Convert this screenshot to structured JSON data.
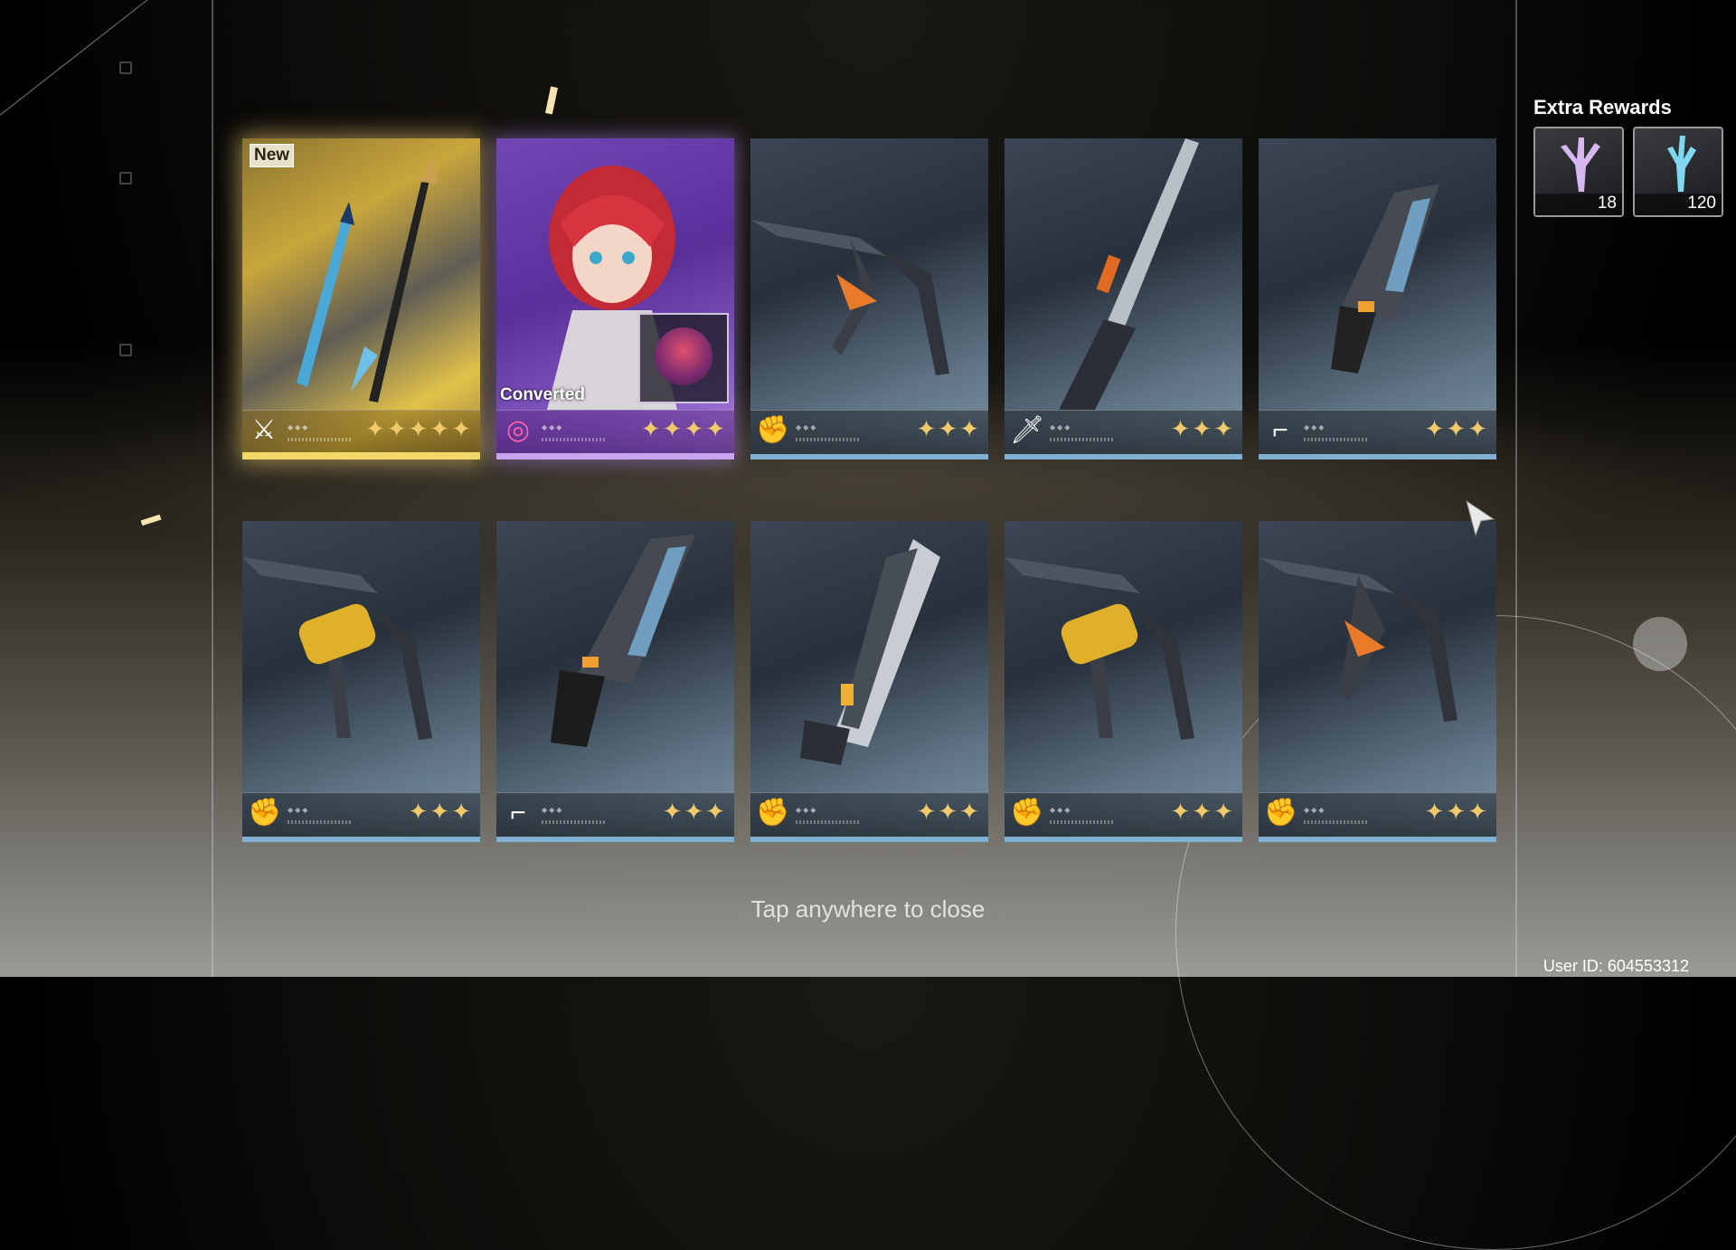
{
  "extra_rewards": {
    "title": "Extra Rewards",
    "items": [
      {
        "icon": "lustrous-coral-icon",
        "quantity": "18"
      },
      {
        "icon": "coral-icon",
        "quantity": "120"
      }
    ]
  },
  "cards": [
    {
      "badge": "New",
      "rarity": 5,
      "stars": "✦✦✦✦✦",
      "type_icon": "sword-type-icon",
      "item_icon": "katana-weapon-icon",
      "frame": "gold"
    },
    {
      "label": "Converted",
      "rarity": 4,
      "stars": "✦✦✦✦",
      "type_icon": "havoc-element-icon",
      "item_icon": "red-haired-resonator-portrait",
      "frame": "purple"
    },
    {
      "rarity": 3,
      "stars": "✦✦✦",
      "type_icon": "gauntlet-type-icon",
      "item_icon": "gauntlet-weapon-icon",
      "frame": "blue"
    },
    {
      "rarity": 3,
      "stars": "✦✦✦",
      "type_icon": "broadblade-type-icon",
      "item_icon": "broadblade-weapon-icon",
      "frame": "blue"
    },
    {
      "rarity": 3,
      "stars": "✦✦✦",
      "type_icon": "pistol-type-icon",
      "item_icon": "pistol-weapon-icon",
      "frame": "blue"
    },
    {
      "rarity": 3,
      "stars": "✦✦✦",
      "type_icon": "gauntlet-type-icon",
      "item_icon": "gold-gauntlet-weapon-icon",
      "frame": "blue"
    },
    {
      "rarity": 3,
      "stars": "✦✦✦",
      "type_icon": "pistol-type-icon",
      "item_icon": "pistol-weapon-icon",
      "frame": "blue"
    },
    {
      "rarity": 3,
      "stars": "✦✦✦",
      "type_icon": "gauntlet-type-icon",
      "item_icon": "rectifier-weapon-icon",
      "frame": "blue"
    },
    {
      "rarity": 3,
      "stars": "✦✦✦",
      "type_icon": "gauntlet-type-icon",
      "item_icon": "gold-gauntlet-weapon-icon",
      "frame": "blue"
    },
    {
      "rarity": 3,
      "stars": "✦✦✦",
      "type_icon": "gauntlet-type-icon",
      "item_icon": "gauntlet-weapon-icon",
      "frame": "blue"
    }
  ],
  "hint": "Tap anywhere to close",
  "user_id": "User ID: 604553312"
}
